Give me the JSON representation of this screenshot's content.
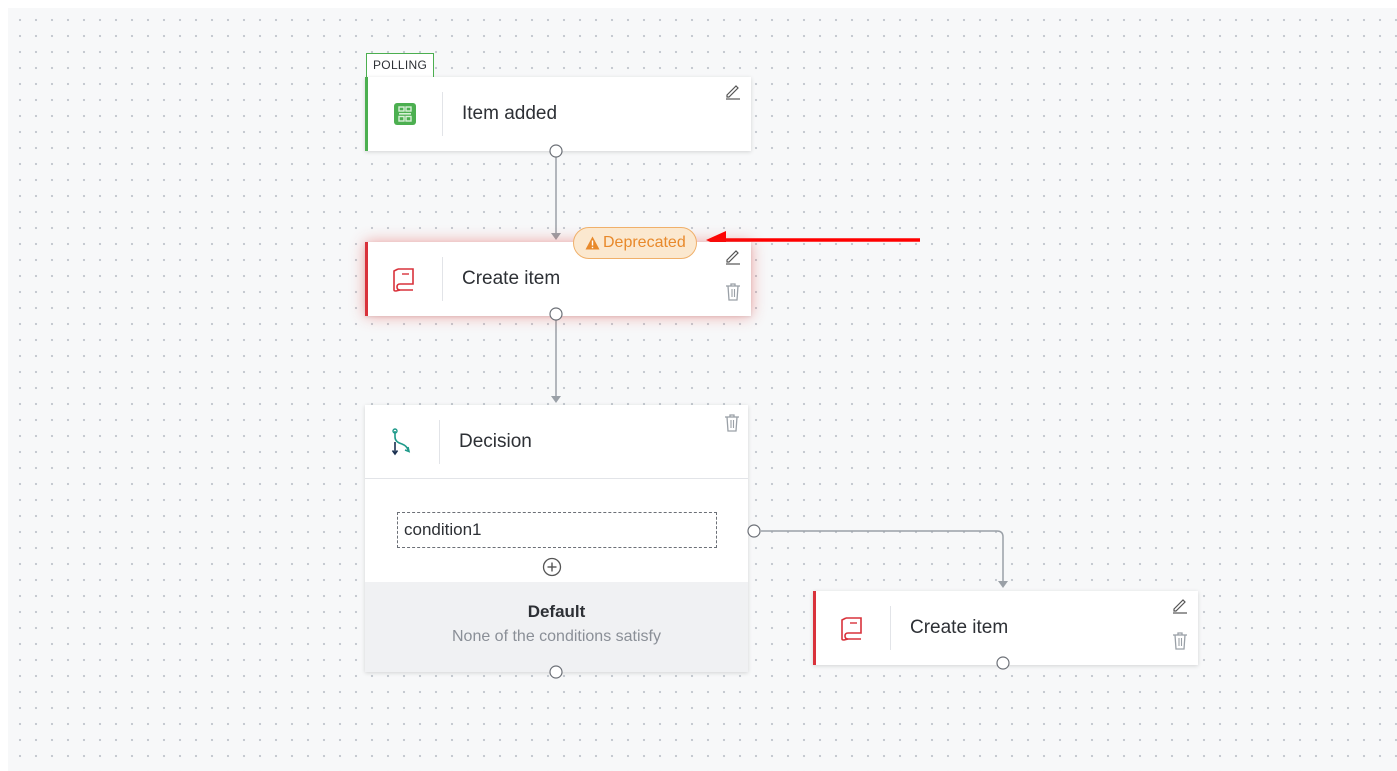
{
  "colors": {
    "trigger_accent": "#4caf50",
    "action_accent": "#d9323b",
    "decision_accent": "#1f9a8a",
    "deprecated_text": "#e8892b",
    "deprecated_bg": "#fbe8cf",
    "annotation_arrow": "#ff0000"
  },
  "trigger": {
    "tag": "POLLING",
    "title": "Item added",
    "icon": "item-grid-icon"
  },
  "action_1": {
    "badge": "Deprecated",
    "badge_icon": "warning-icon",
    "title": "Create item",
    "icon": "book-icon"
  },
  "decision": {
    "title": "Decision",
    "icon": "branch-icon",
    "condition": "condition1",
    "default_title": "Default",
    "default_subtitle": "None of the conditions satisfy"
  },
  "action_2": {
    "title": "Create item",
    "icon": "book-icon"
  }
}
